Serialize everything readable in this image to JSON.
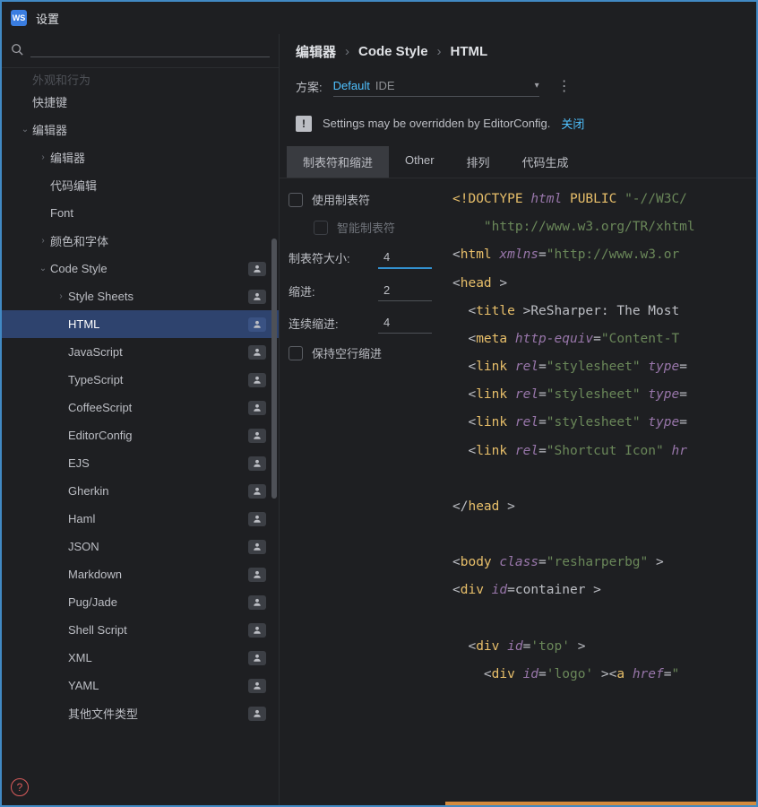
{
  "window": {
    "title": "设置"
  },
  "breadcrumb": [
    "编辑器",
    "Code Style",
    "HTML"
  ],
  "scheme": {
    "label": "方案:",
    "value_primary": "Default",
    "value_secondary": "IDE"
  },
  "banner": {
    "text": "Settings may be overridden by EditorConfig.",
    "link": "关闭"
  },
  "tabs": [
    "制表符和缩进",
    "Other",
    "排列",
    "代码生成"
  ],
  "form": {
    "use_tab": "使用制表符",
    "smart_tab": "智能制表符",
    "tab_size_label": "制表符大小:",
    "tab_size_value": "4",
    "indent_label": "缩进:",
    "indent_value": "2",
    "cont_indent_label": "连续缩进:",
    "cont_indent_value": "4",
    "keep_blank": "保持空行缩进"
  },
  "tree": {
    "items": [
      {
        "label": "外观和行为",
        "depth": 0,
        "arrow": "",
        "badge": false,
        "truncated": true
      },
      {
        "label": "快捷键",
        "depth": 0,
        "arrow": "",
        "badge": false
      },
      {
        "label": "编辑器",
        "depth": 0,
        "arrow": "v",
        "badge": false
      },
      {
        "label": "编辑器",
        "depth": 1,
        "arrow": ">",
        "badge": false
      },
      {
        "label": "代码编辑",
        "depth": 1,
        "arrow": "",
        "badge": false
      },
      {
        "label": "Font",
        "depth": 1,
        "arrow": "",
        "badge": false
      },
      {
        "label": "颜色和字体",
        "depth": 1,
        "arrow": ">",
        "badge": false
      },
      {
        "label": "Code Style",
        "depth": 1,
        "arrow": "v",
        "badge": true
      },
      {
        "label": "Style Sheets",
        "depth": 2,
        "arrow": ">",
        "badge": true
      },
      {
        "label": "HTML",
        "depth": 2,
        "arrow": "",
        "badge": true,
        "selected": true
      },
      {
        "label": "JavaScript",
        "depth": 2,
        "arrow": "",
        "badge": true
      },
      {
        "label": "TypeScript",
        "depth": 2,
        "arrow": "",
        "badge": true
      },
      {
        "label": "CoffeeScript",
        "depth": 2,
        "arrow": "",
        "badge": true
      },
      {
        "label": "EditorConfig",
        "depth": 2,
        "arrow": "",
        "badge": true
      },
      {
        "label": "EJS",
        "depth": 2,
        "arrow": "",
        "badge": true
      },
      {
        "label": "Gherkin",
        "depth": 2,
        "arrow": "",
        "badge": true
      },
      {
        "label": "Haml",
        "depth": 2,
        "arrow": "",
        "badge": true
      },
      {
        "label": "JSON",
        "depth": 2,
        "arrow": "",
        "badge": true
      },
      {
        "label": "Markdown",
        "depth": 2,
        "arrow": "",
        "badge": true
      },
      {
        "label": "Pug/Jade",
        "depth": 2,
        "arrow": "",
        "badge": true
      },
      {
        "label": "Shell Script",
        "depth": 2,
        "arrow": "",
        "badge": true
      },
      {
        "label": "XML",
        "depth": 2,
        "arrow": "",
        "badge": true
      },
      {
        "label": "YAML",
        "depth": 2,
        "arrow": "",
        "badge": true
      },
      {
        "label": "其他文件类型",
        "depth": 2,
        "arrow": "",
        "badge": true
      }
    ]
  },
  "preview_lines": [
    [
      [
        "doctype",
        "<!"
      ],
      [
        "tag",
        "DOCTYPE "
      ],
      [
        "kw",
        "html "
      ],
      [
        "tag",
        "PUBLIC "
      ],
      [
        "str",
        "\"-//W3C/"
      ]
    ],
    [
      [
        "pad",
        "    "
      ],
      [
        "str",
        "\"http://www.w3.org/TR/xhtml"
      ]
    ],
    [
      [
        "punc",
        "<"
      ],
      [
        "tag",
        "html "
      ],
      [
        "kw",
        "xmlns"
      ],
      [
        "punc",
        "="
      ],
      [
        "str",
        "\"http://www.w3.or"
      ]
    ],
    [
      [
        "punc",
        "<"
      ],
      [
        "tag",
        "head "
      ],
      [
        "punc",
        ">"
      ]
    ],
    [
      [
        "pad",
        "  "
      ],
      [
        "punc",
        "<"
      ],
      [
        "tag",
        "title "
      ],
      [
        "punc",
        ">"
      ],
      [
        "txt",
        "ReSharper: The Most"
      ]
    ],
    [
      [
        "pad",
        "  "
      ],
      [
        "punc",
        "<"
      ],
      [
        "tag",
        "meta "
      ],
      [
        "kw",
        "http-equiv"
      ],
      [
        "punc",
        "="
      ],
      [
        "str",
        "\"Content-T"
      ]
    ],
    [
      [
        "pad",
        "  "
      ],
      [
        "punc",
        "<"
      ],
      [
        "tag",
        "link "
      ],
      [
        "kw",
        "rel"
      ],
      [
        "punc",
        "="
      ],
      [
        "str",
        "\"stylesheet\" "
      ],
      [
        "kw",
        "type"
      ],
      [
        "punc",
        "="
      ]
    ],
    [
      [
        "pad",
        "  "
      ],
      [
        "punc",
        "<"
      ],
      [
        "tag",
        "link "
      ],
      [
        "kw",
        "rel"
      ],
      [
        "punc",
        "="
      ],
      [
        "str",
        "\"stylesheet\" "
      ],
      [
        "kw",
        "type"
      ],
      [
        "punc",
        "="
      ]
    ],
    [
      [
        "pad",
        "  "
      ],
      [
        "punc",
        "<"
      ],
      [
        "tag",
        "link "
      ],
      [
        "kw",
        "rel"
      ],
      [
        "punc",
        "="
      ],
      [
        "str",
        "\"stylesheet\" "
      ],
      [
        "kw",
        "type"
      ],
      [
        "punc",
        "="
      ]
    ],
    [
      [
        "pad",
        "  "
      ],
      [
        "punc",
        "<"
      ],
      [
        "tag",
        "link "
      ],
      [
        "kw",
        "rel"
      ],
      [
        "punc",
        "="
      ],
      [
        "str",
        "\"Shortcut Icon\" "
      ],
      [
        "kw",
        "hr"
      ]
    ],
    [
      [
        "pad",
        " "
      ]
    ],
    [
      [
        "punc",
        "</"
      ],
      [
        "tag",
        "head "
      ],
      [
        "punc",
        ">"
      ]
    ],
    [
      [
        "pad",
        " "
      ]
    ],
    [
      [
        "punc",
        "<"
      ],
      [
        "tag",
        "body "
      ],
      [
        "kw",
        "class"
      ],
      [
        "punc",
        "="
      ],
      [
        "str",
        "\"resharperbg\" "
      ],
      [
        "punc",
        ">"
      ]
    ],
    [
      [
        "punc",
        "<"
      ],
      [
        "tag",
        "div "
      ],
      [
        "kw",
        "id"
      ],
      [
        "punc",
        "="
      ],
      [
        "txt",
        "container "
      ],
      [
        "punc",
        ">"
      ]
    ],
    [
      [
        "pad",
        " "
      ]
    ],
    [
      [
        "pad",
        "  "
      ],
      [
        "punc",
        "<"
      ],
      [
        "tag",
        "div "
      ],
      [
        "kw",
        "id"
      ],
      [
        "punc",
        "="
      ],
      [
        "str",
        "'top' "
      ],
      [
        "punc",
        ">"
      ]
    ],
    [
      [
        "pad",
        "    "
      ],
      [
        "punc",
        "<"
      ],
      [
        "tag",
        "div "
      ],
      [
        "kw",
        "id"
      ],
      [
        "punc",
        "="
      ],
      [
        "str",
        "'logo' "
      ],
      [
        "punc",
        "><"
      ],
      [
        "tag",
        "a "
      ],
      [
        "kw",
        "href"
      ],
      [
        "punc",
        "="
      ],
      [
        "str",
        "\""
      ]
    ]
  ]
}
